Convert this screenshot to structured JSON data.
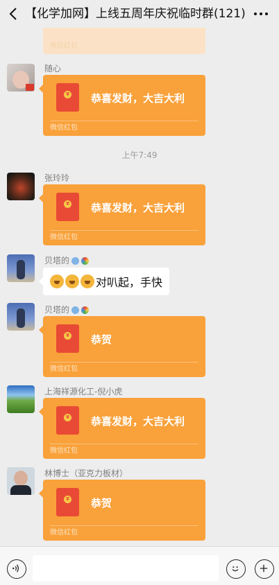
{
  "header": {
    "title": "【化学加网】上线五周年庆祝临时群(121)"
  },
  "colors": {
    "packet": "#f9a13a",
    "envelope": "#e94a35",
    "background": "#ededed"
  },
  "timestamp": "上午7:49",
  "packet_footer": "微信红包",
  "messages": [
    {
      "sender": "随心",
      "text": "恭喜发财，大吉大利"
    },
    {
      "sender": "张玲玲",
      "text": "恭喜发财，大吉大利"
    },
    {
      "sender": "贝塔的",
      "text": "对叭起，手快"
    },
    {
      "sender": "贝塔的",
      "text": "恭贺"
    },
    {
      "sender": "上海祥源化工-倪小虎",
      "text": "恭喜发财，大吉大利"
    },
    {
      "sender": "林博士（亚克力板材）",
      "text": "恭贺"
    }
  ],
  "icons": [
    "back-icon",
    "more-icon",
    "voice-icon",
    "emoji-icon",
    "plus-icon"
  ]
}
